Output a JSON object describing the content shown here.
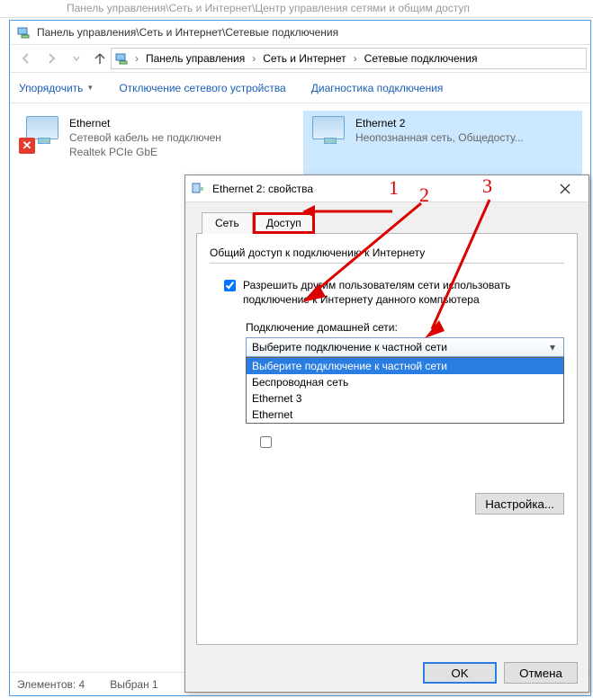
{
  "ghost_title": "Панель управления\\Сеть и Интернет\\Центр управления сетями и общим доступ",
  "window": {
    "title": "Панель управления\\Сеть и Интернет\\Сетевые подключения"
  },
  "breadcrumb": {
    "items": [
      "Панель управления",
      "Сеть и Интернет",
      "Сетевые подключения"
    ]
  },
  "toolbar": {
    "organize": "Упорядочить",
    "disable": "Отключение сетевого устройства",
    "diagnose": "Диагностика подключения"
  },
  "connections": [
    {
      "name": "Ethernet",
      "status": "Сетевой кабель не подключен",
      "device": "Realtek PCIe GbE",
      "error": true,
      "selected": false
    },
    {
      "name": "Ethernet 2",
      "status": "Неопознанная сеть, Общедосту...",
      "device": "",
      "error": false,
      "selected": true
    }
  ],
  "status_bar": {
    "elements": "Элементов: 4",
    "selected": "Выбран 1"
  },
  "dialog": {
    "title": "Ethernet 2: свойства",
    "tabs": {
      "network": "Сеть",
      "sharing": "Доступ"
    },
    "group_label": "Общий доступ к подключению к Интернету",
    "allow_share": "Разрешить другим пользователям сети использовать подключение к Интернету данного компьютера",
    "home_conn_label": "Подключение домашней сети:",
    "combo_selected": "Выберите подключение к частной сети",
    "combo_items": [
      "Выберите подключение к частной сети",
      "Беспроводная сеть",
      "Ethernet 3",
      "Ethernet"
    ],
    "settings_btn": "Настройка...",
    "ok": "OK",
    "cancel": "Отмена"
  },
  "annotations": {
    "n1": "1",
    "n2": "2",
    "n3": "3"
  }
}
